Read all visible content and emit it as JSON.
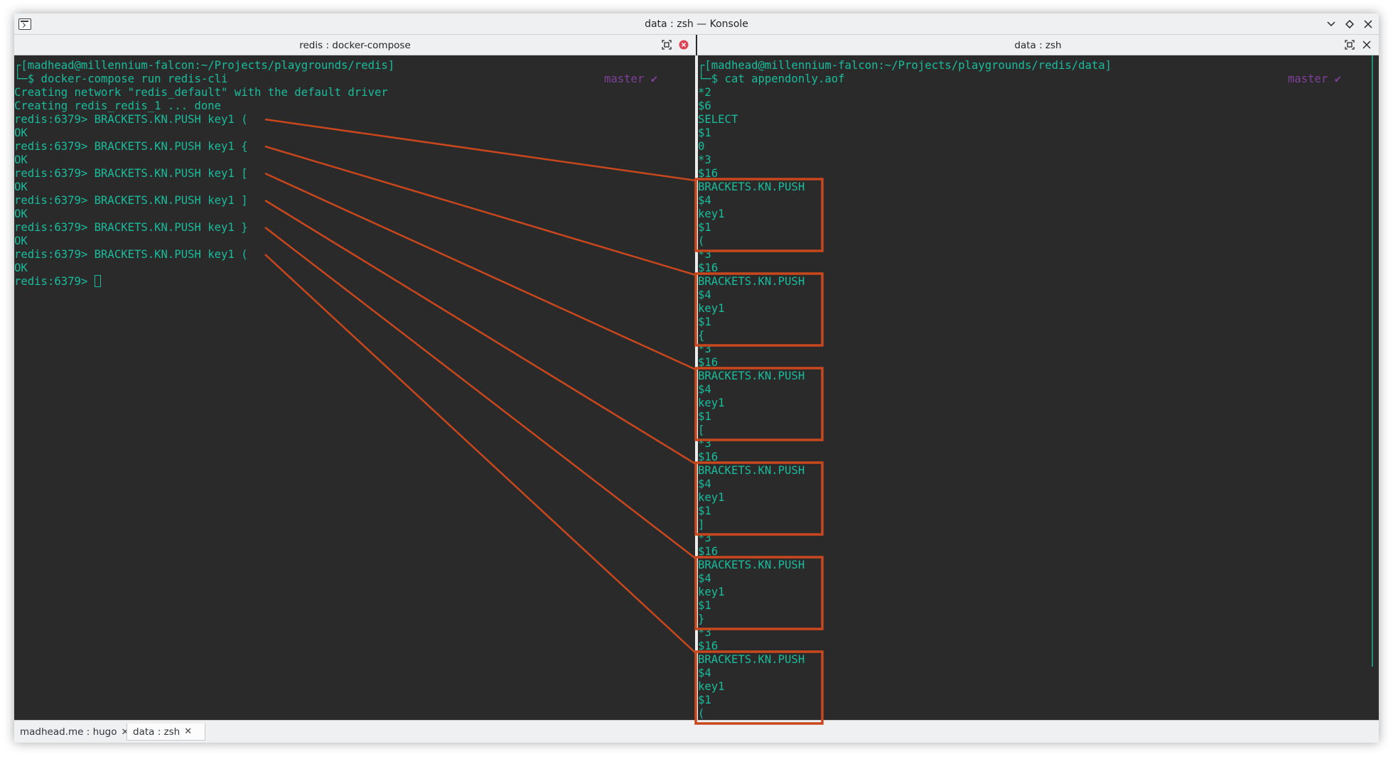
{
  "window": {
    "title": "data : zsh — Konsole"
  },
  "left_pane": {
    "header": "redis : docker-compose",
    "git_status": "master ✔",
    "lines": [
      "┌[madhead@millennium-falcon:~/Projects/playgrounds/redis]",
      "└─$ docker-compose run redis-cli",
      "Creating network \"redis_default\" with the default driver",
      "Creating redis_redis_1 ... done",
      "redis:6379> BRACKETS.KN.PUSH key1 (",
      "OK",
      "redis:6379> BRACKETS.KN.PUSH key1 {",
      "OK",
      "redis:6379> BRACKETS.KN.PUSH key1 [",
      "OK",
      "redis:6379> BRACKETS.KN.PUSH key1 ]",
      "OK",
      "redis:6379> BRACKETS.KN.PUSH key1 }",
      "OK",
      "redis:6379> BRACKETS.KN.PUSH key1 (",
      "OK",
      "redis:6379> "
    ]
  },
  "right_pane": {
    "header": "data : zsh",
    "git_status": "master ✔",
    "lines": [
      "┌[madhead@millennium-falcon:~/Projects/playgrounds/redis/data]",
      "└─$ cat appendonly.aof",
      "*2",
      "$6",
      "SELECT",
      "$1",
      "0",
      "*3",
      "$16",
      "BRACKETS.KN.PUSH",
      "$4",
      "key1",
      "$1",
      "(",
      "*3",
      "$16",
      "BRACKETS.KN.PUSH",
      "$4",
      "key1",
      "$1",
      "{",
      "*3",
      "$16",
      "BRACKETS.KN.PUSH",
      "$4",
      "key1",
      "$1",
      "[",
      "*3",
      "$16",
      "BRACKETS.KN.PUSH",
      "$4",
      "key1",
      "$1",
      "]",
      "*3",
      "$16",
      "BRACKETS.KN.PUSH",
      "$4",
      "key1",
      "$1",
      "}",
      "*3",
      "$16",
      "BRACKETS.KN.PUSH",
      "$4",
      "key1",
      "$1",
      "("
    ]
  },
  "tabs": [
    {
      "label": "madhead.me : hugo",
      "active": false
    },
    {
      "label": "data : zsh",
      "active": true
    }
  ],
  "annotation_color": "#c9471d"
}
